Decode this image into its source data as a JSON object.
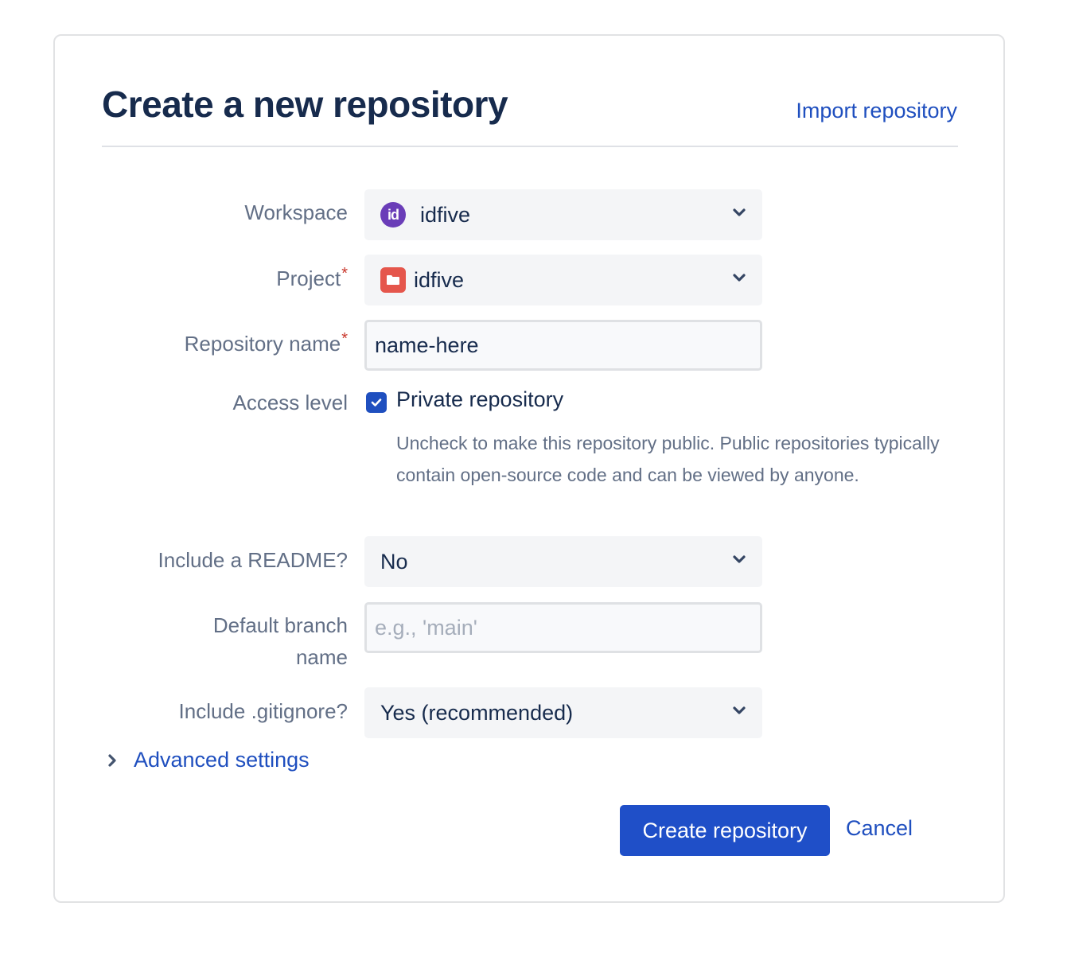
{
  "header": {
    "title": "Create a new repository",
    "import_link": "Import repository"
  },
  "form": {
    "workspace": {
      "label": "Workspace",
      "icon": "workspace-avatar-icon",
      "icon_text": "id",
      "value": "idfive"
    },
    "project": {
      "label": "Project",
      "required_marker": "*",
      "icon": "folder-icon",
      "value": "idfive"
    },
    "repository_name": {
      "label": "Repository name",
      "required_marker": "*",
      "value": "name-here"
    },
    "access_level": {
      "label": "Access level",
      "checkbox_label": "Private repository",
      "checked": true,
      "helper_text": "Uncheck to make this repository public. Public repositories typically contain open-source code and can be viewed by anyone."
    },
    "readme": {
      "label": "Include a README?",
      "value": "No"
    },
    "default_branch": {
      "label": "Default branch name",
      "value": "",
      "placeholder": "e.g., 'main'"
    },
    "gitignore": {
      "label": "Include .gitignore?",
      "value": "Yes (recommended)"
    },
    "advanced_settings": "Advanced settings"
  },
  "actions": {
    "create_label": "Create repository",
    "cancel_label": "Cancel"
  },
  "colors": {
    "primary": "#1f4fc8",
    "link": "#1f4fbf",
    "required": "#c9372c",
    "workspace_avatar": "#6a3db8",
    "project_icon": "#e5564c"
  }
}
